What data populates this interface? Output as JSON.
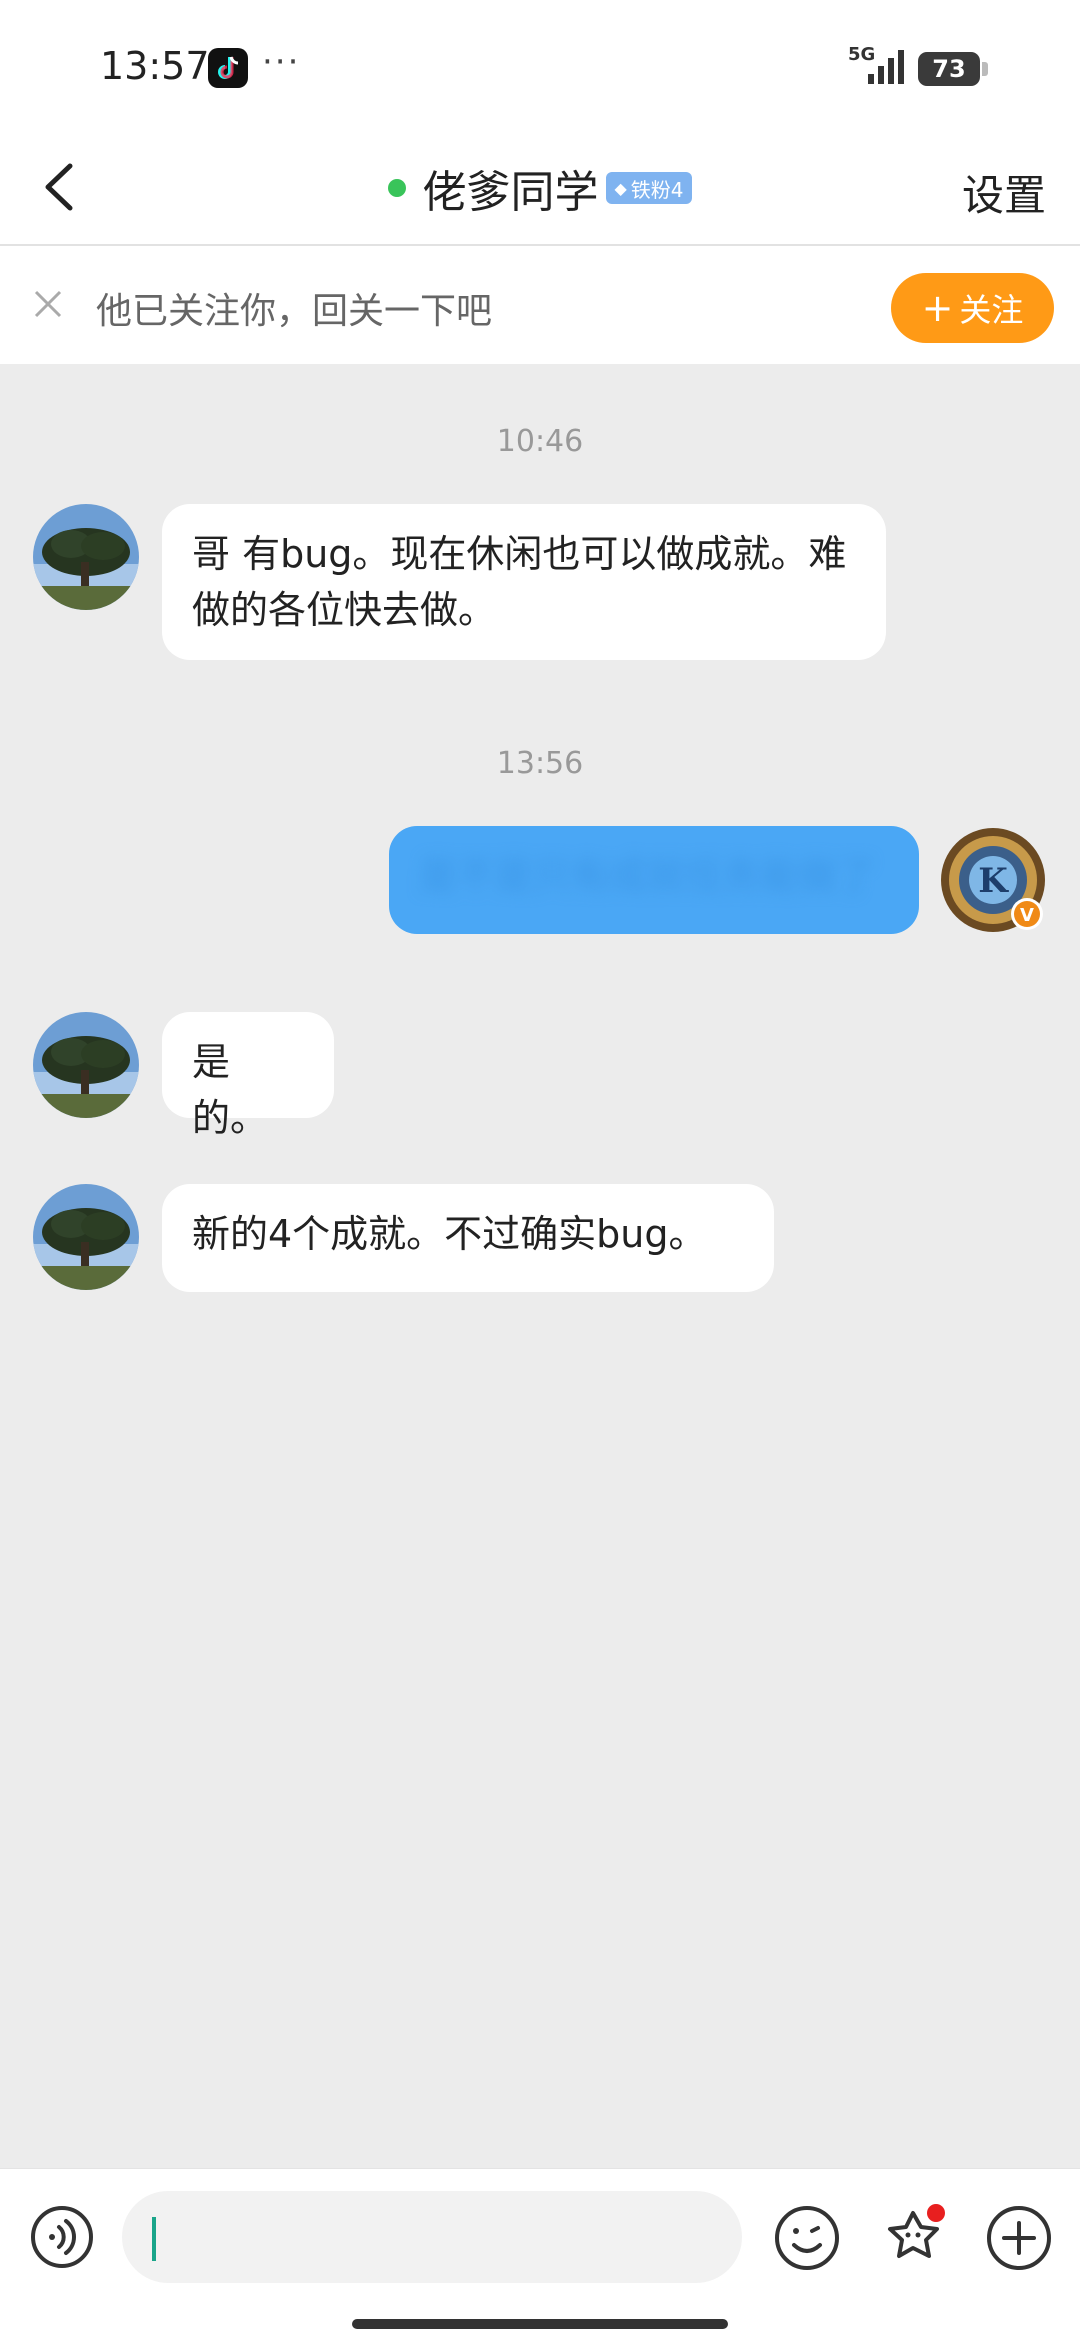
{
  "status": {
    "time": "13:57",
    "more": "···",
    "network": "5G",
    "battery": "73"
  },
  "nav": {
    "title": "佬爹同学",
    "badge": "铁粉4",
    "settings": "设置"
  },
  "follow_bar": {
    "text": "他已关注你，回关一下吧",
    "button": "关注",
    "button_color": "#ff9a16"
  },
  "chat": {
    "timestamps": [
      "10:46",
      "13:56"
    ],
    "messages": [
      {
        "from": "other",
        "text": "哥 有bug。现在休闲也可以做成就。难做的各位快去做。"
      },
      {
        "from": "me",
        "text": "是不是只有成就任务能做了"
      },
      {
        "from": "other",
        "text": "是的。"
      },
      {
        "from": "other",
        "text": "新的4个成就。不过确实bug。"
      }
    ]
  },
  "input": {
    "placeholder": ""
  },
  "colors": {
    "background": "#ececec",
    "my_bubble": "#4aa7f5",
    "online_dot": "#39c45a",
    "badge": "#7fb3f0"
  },
  "icons": [
    "back-icon",
    "close-icon",
    "voice-icon",
    "emoji-icon",
    "sticker-icon",
    "plus-icon",
    "signal-icon",
    "battery-icon",
    "tiktok-icon"
  ]
}
